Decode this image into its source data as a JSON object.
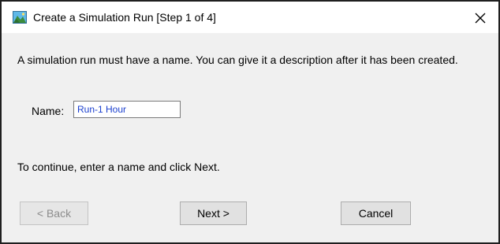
{
  "window": {
    "title": "Create a Simulation Run [Step 1 of 4]",
    "icon": "landscape-map-icon",
    "close_icon": "close-icon"
  },
  "main": {
    "description": "A simulation run must have a name. You can give it a description after it has been created.",
    "name_label": "Name:",
    "name_value": "Run-1 Hour",
    "hint": "To continue, enter a name and click Next."
  },
  "buttons": {
    "back": "< Back",
    "back_enabled": false,
    "next": "Next >",
    "cancel": "Cancel"
  },
  "colors": {
    "input_text": "#1a3fcf",
    "dialog_background": "#f0f0f0",
    "button_face": "#e1e1e1"
  }
}
